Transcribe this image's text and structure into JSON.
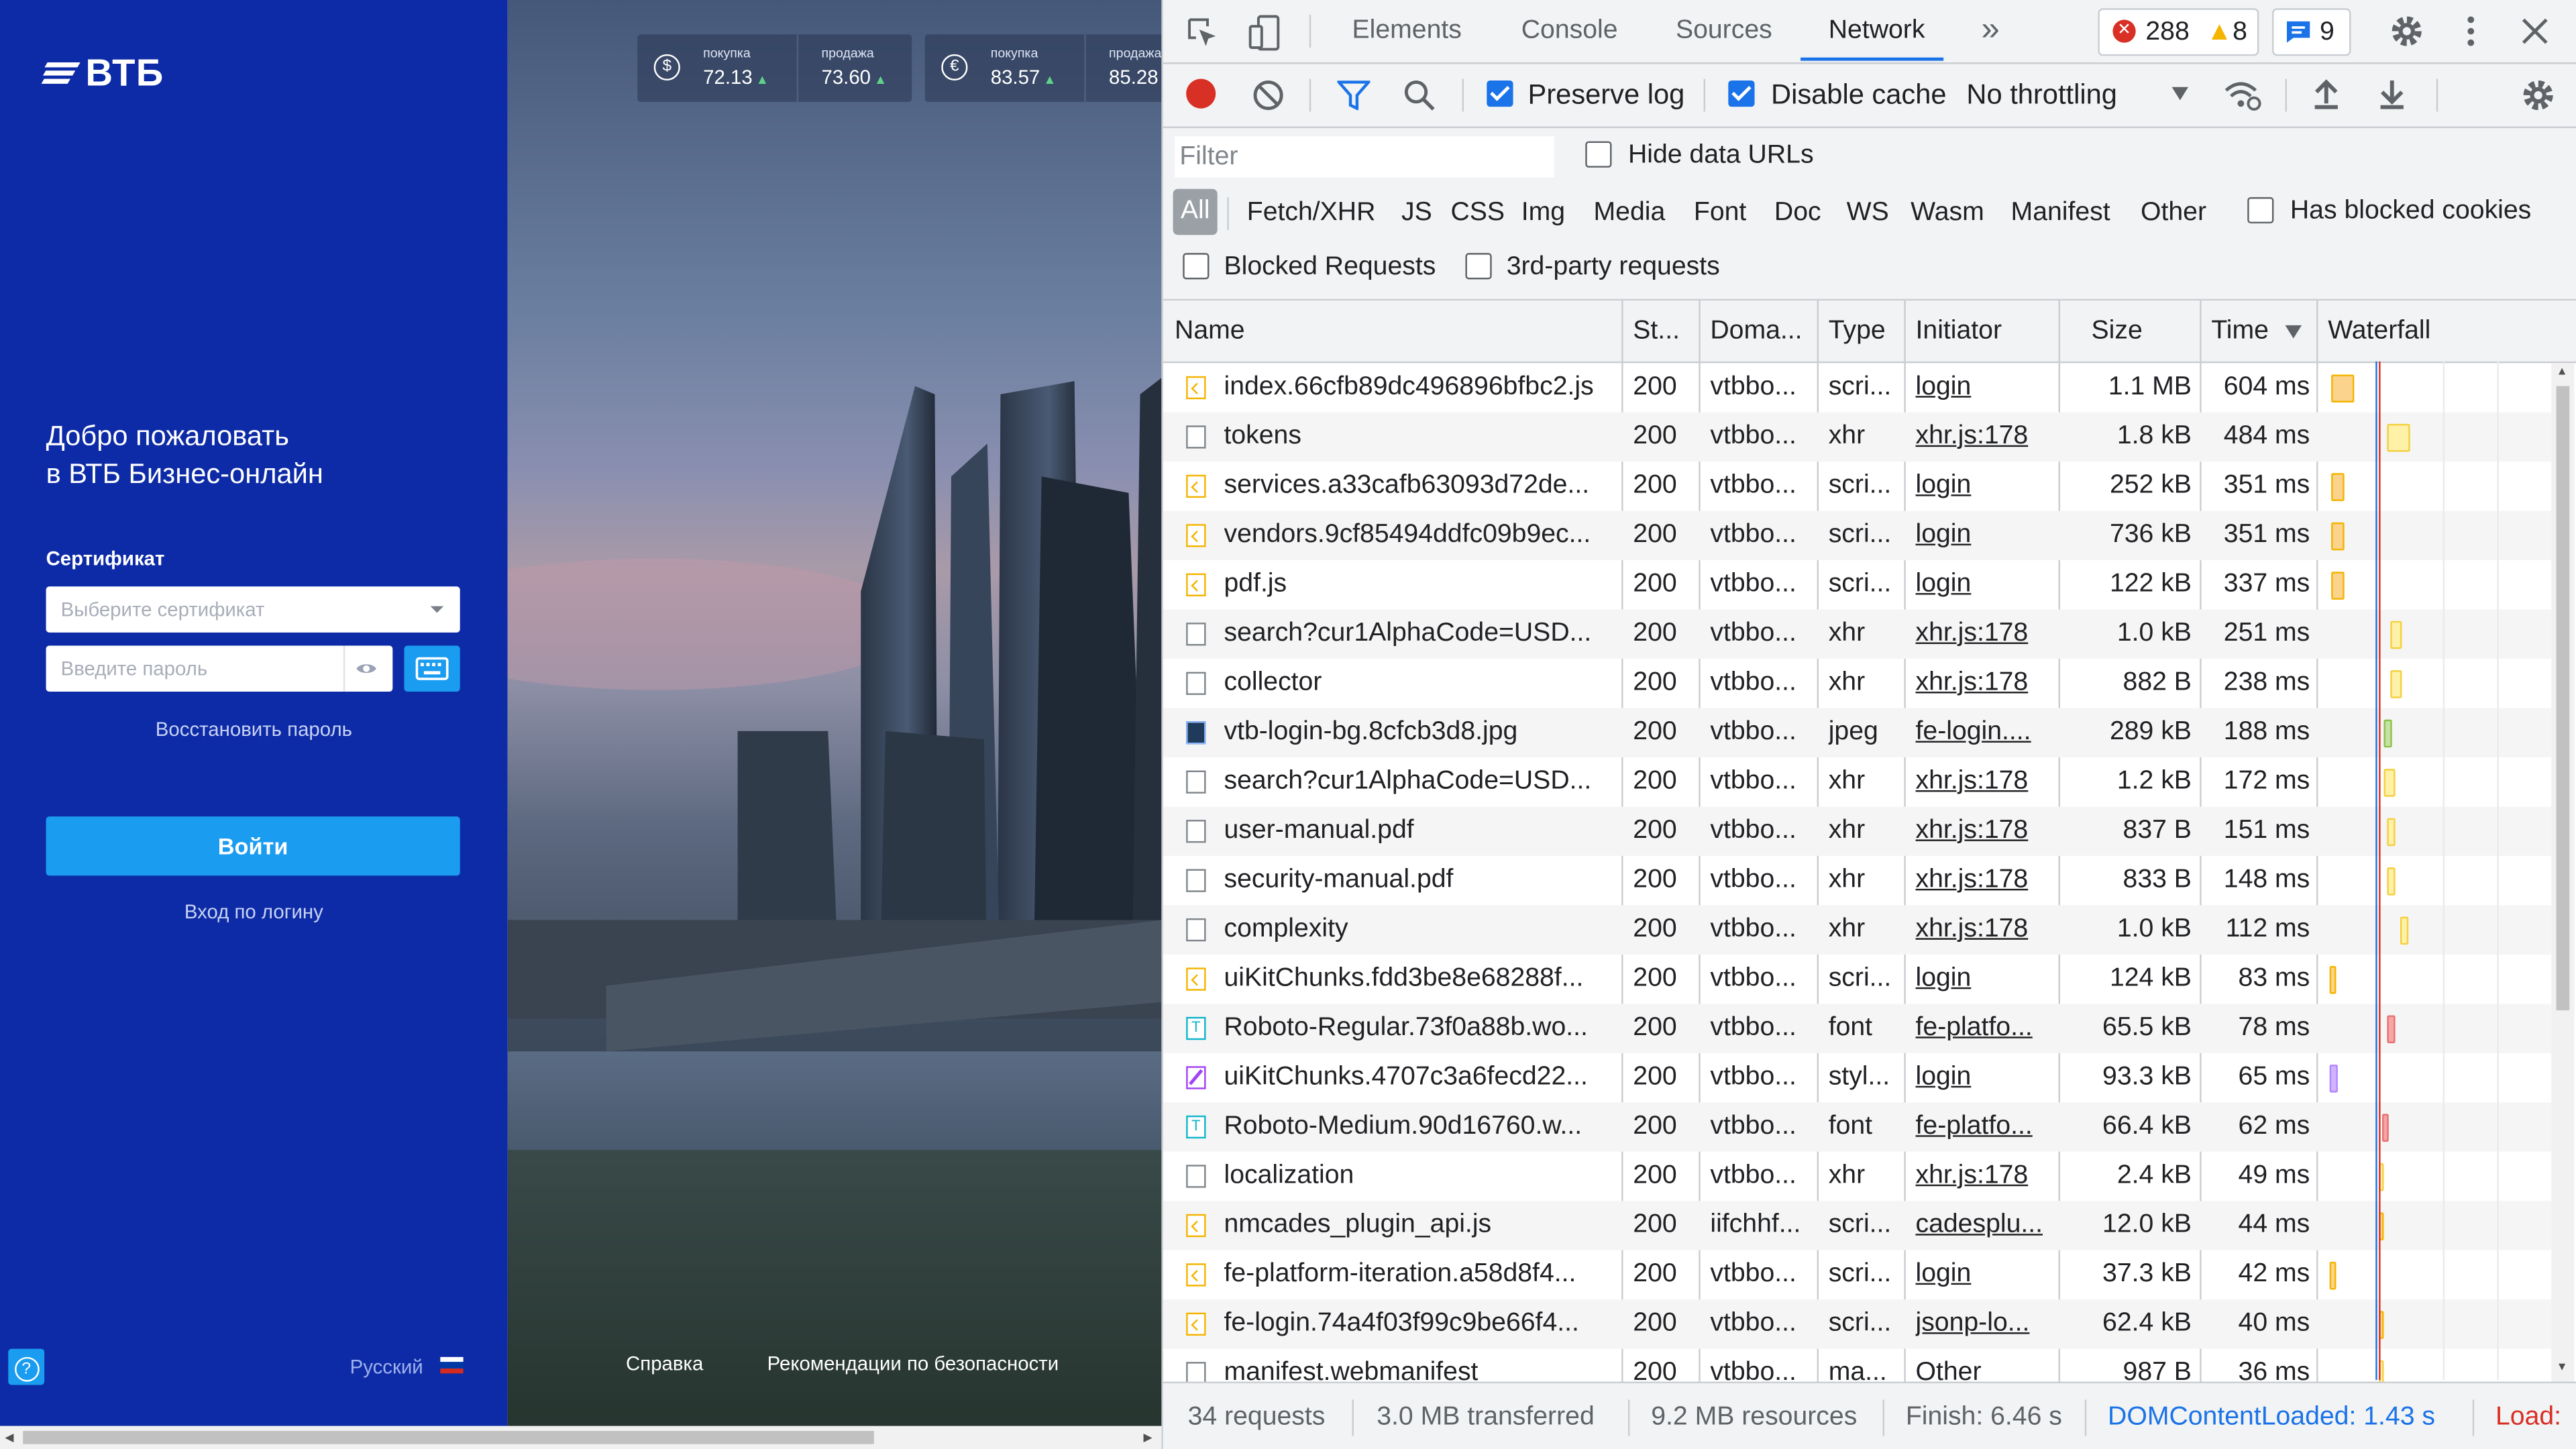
{
  "site": {
    "logo": "ВТБ",
    "welcome_line1": "Добро пожаловать",
    "welcome_line2": "в ВТБ Бизнес-онлайн",
    "certificate_label": "Сертификат",
    "certificate_placeholder": "Выберите сертификат",
    "password_placeholder": "Введите пароль",
    "restore_password": "Восстановить пароль",
    "login_button": "Войти",
    "login_by_username": "Вход по логину",
    "help": "?",
    "language": "Русский",
    "footer_help": "Справка",
    "footer_security": "Рекомендации по безопасности",
    "rates": [
      {
        "currency_icon": "dollar-icon",
        "symbol": "$",
        "buy_caption": "покупка",
        "buy_value": "72.13",
        "sell_caption": "продажа",
        "sell_value": "73.60"
      },
      {
        "currency_icon": "euro-icon",
        "symbol": "€",
        "buy_caption": "покупка",
        "buy_value": "83.57",
        "sell_caption": "продажа",
        "sell_value": "85.28"
      }
    ],
    "colors": {
      "panel": "#0d2ba6",
      "accent": "#1a9cf0"
    }
  },
  "devtools": {
    "tabs": [
      "Elements",
      "Console",
      "Sources",
      "Network"
    ],
    "active_tab": "Network",
    "more_tabs": "»",
    "errors_count": "288",
    "warnings_count": "8",
    "messages_count": "9",
    "toolbar": {
      "preserve_log": "Preserve log",
      "preserve_log_checked": true,
      "disable_cache": "Disable cache",
      "disable_cache_checked": true,
      "throttling": "No throttling"
    },
    "filter": {
      "placeholder": "Filter",
      "hide_data_urls": "Hide data URLs",
      "types": [
        "All",
        "Fetch/XHR",
        "JS",
        "CSS",
        "Img",
        "Media",
        "Font",
        "Doc",
        "WS",
        "Wasm",
        "Manifest",
        "Other"
      ],
      "has_blocked_cookies": "Has blocked cookies",
      "blocked_requests": "Blocked Requests",
      "third_party": "3rd-party requests"
    },
    "columns": {
      "name": "Name",
      "status": "St...",
      "domain": "Doma...",
      "type": "Type",
      "initiator": "Initiator",
      "size": "Size",
      "time": "Time",
      "waterfall": "Waterfall"
    },
    "requests": [
      {
        "icon": "script",
        "name": "index.66cfb89dc496896bfbc2.js",
        "status": "200",
        "domain": "vtbbo...",
        "type": "scri...",
        "initiator": "login",
        "size": "1.1 MB",
        "time": "604 ms"
      },
      {
        "icon": "doc",
        "name": "tokens",
        "status": "200",
        "domain": "vtbbo...",
        "type": "xhr",
        "initiator": "xhr.js:178",
        "size": "1.8 kB",
        "time": "484 ms"
      },
      {
        "icon": "script",
        "name": "services.a33cafb63093d72de...",
        "status": "200",
        "domain": "vtbbo...",
        "type": "scri...",
        "initiator": "login",
        "size": "252 kB",
        "time": "351 ms"
      },
      {
        "icon": "script",
        "name": "vendors.9cf85494ddfc09b9ec...",
        "status": "200",
        "domain": "vtbbo...",
        "type": "scri...",
        "initiator": "login",
        "size": "736 kB",
        "time": "351 ms"
      },
      {
        "icon": "script",
        "name": "pdf.js",
        "status": "200",
        "domain": "vtbbo...",
        "type": "scri...",
        "initiator": "login",
        "size": "122 kB",
        "time": "337 ms"
      },
      {
        "icon": "doc",
        "name": "search?cur1AlphaCode=USD...",
        "status": "200",
        "domain": "vtbbo...",
        "type": "xhr",
        "initiator": "xhr.js:178",
        "size": "1.0 kB",
        "time": "251 ms"
      },
      {
        "icon": "doc",
        "name": "collector",
        "status": "200",
        "domain": "vtbbo...",
        "type": "xhr",
        "initiator": "xhr.js:178",
        "size": "882 B",
        "time": "238 ms"
      },
      {
        "icon": "img",
        "name": "vtb-login-bg.8cfcb3d8.jpg",
        "status": "200",
        "domain": "vtbbo...",
        "type": "jpeg",
        "initiator": "fe-login....",
        "size": "289 kB",
        "time": "188 ms"
      },
      {
        "icon": "doc",
        "name": "search?cur1AlphaCode=USD...",
        "status": "200",
        "domain": "vtbbo...",
        "type": "xhr",
        "initiator": "xhr.js:178",
        "size": "1.2 kB",
        "time": "172 ms"
      },
      {
        "icon": "doc",
        "name": "user-manual.pdf",
        "status": "200",
        "domain": "vtbbo...",
        "type": "xhr",
        "initiator": "xhr.js:178",
        "size": "837 B",
        "time": "151 ms"
      },
      {
        "icon": "doc",
        "name": "security-manual.pdf",
        "status": "200",
        "domain": "vtbbo...",
        "type": "xhr",
        "initiator": "xhr.js:178",
        "size": "833 B",
        "time": "148 ms"
      },
      {
        "icon": "doc",
        "name": "complexity",
        "status": "200",
        "domain": "vtbbo...",
        "type": "xhr",
        "initiator": "xhr.js:178",
        "size": "1.0 kB",
        "time": "112 ms"
      },
      {
        "icon": "script",
        "name": "uiKitChunks.fdd3be8e68288f...",
        "status": "200",
        "domain": "vtbbo...",
        "type": "scri...",
        "initiator": "login",
        "size": "124 kB",
        "time": "83 ms"
      },
      {
        "icon": "font",
        "name": "Roboto-Regular.73f0a88b.wo...",
        "status": "200",
        "domain": "vtbbo...",
        "type": "font",
        "initiator": "fe-platfo...",
        "size": "65.5 kB",
        "time": "78 ms"
      },
      {
        "icon": "style",
        "name": "uiKitChunks.4707c3a6fecd22...",
        "status": "200",
        "domain": "vtbbo...",
        "type": "styl...",
        "initiator": "login",
        "size": "93.3 kB",
        "time": "65 ms"
      },
      {
        "icon": "font",
        "name": "Roboto-Medium.90d16760.w...",
        "status": "200",
        "domain": "vtbbo...",
        "type": "font",
        "initiator": "fe-platfo...",
        "size": "66.4 kB",
        "time": "62 ms"
      },
      {
        "icon": "doc",
        "name": "localization",
        "status": "200",
        "domain": "vtbbo...",
        "type": "xhr",
        "initiator": "xhr.js:178",
        "size": "2.4 kB",
        "time": "49 ms"
      },
      {
        "icon": "script",
        "name": "nmcades_plugin_api.js",
        "status": "200",
        "domain": "iifchhf...",
        "type": "scri...",
        "initiator": "cadesplu...",
        "size": "12.0 kB",
        "time": "44 ms"
      },
      {
        "icon": "script",
        "name": "fe-platform-iteration.a58d8f4...",
        "status": "200",
        "domain": "vtbbo...",
        "type": "scri...",
        "initiator": "login",
        "size": "37.3 kB",
        "time": "42 ms"
      },
      {
        "icon": "script",
        "name": "fe-login.74a4f03f99c9be66f4...",
        "status": "200",
        "domain": "vtbbo...",
        "type": "scri...",
        "initiator": "jsonp-lo...",
        "size": "62.4 kB",
        "time": "40 ms"
      },
      {
        "icon": "doc",
        "name": "manifest.webmanifest",
        "status": "200",
        "domain": "vtbbo...",
        "type": "ma...",
        "initiator": "Other",
        "size": "987 B",
        "time": "36 ms"
      }
    ],
    "status_bar": {
      "requests": "34 requests",
      "transferred": "3.0 MB transferred",
      "resources": "9.2 MB resources",
      "finish": "Finish: 6.46 s",
      "dom_content_loaded": "DOMContentLoaded: 1.43 s",
      "load": "Load:"
    },
    "colors": {
      "accent": "#1a73e8",
      "error": "#d93025",
      "warning": "#f4b400"
    }
  }
}
